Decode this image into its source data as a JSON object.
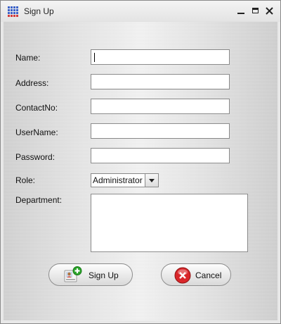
{
  "window": {
    "title": "Sign Up",
    "icons": {
      "app": "grid-app-icon",
      "minimize": "minimize-icon",
      "maximize": "maximize-icon",
      "close": "close-icon"
    }
  },
  "form": {
    "labels": {
      "name": "Name:",
      "address": "Address:",
      "contact": "ContactNo:",
      "username": "UserName:",
      "password": "Password:",
      "role": "Role:",
      "department": "Department:"
    },
    "values": {
      "name": "",
      "address": "",
      "contact": "",
      "username": "",
      "password": "",
      "department": ""
    },
    "role": {
      "selected": "Administrator"
    }
  },
  "buttons": {
    "signup": {
      "label": "Sign Up",
      "icon": "add-user-icon"
    },
    "cancel": {
      "label": "Cancel",
      "icon": "cancel-icon"
    }
  },
  "colors": {
    "accent_green": "#29a329",
    "cancel_red": "#d9262a"
  }
}
